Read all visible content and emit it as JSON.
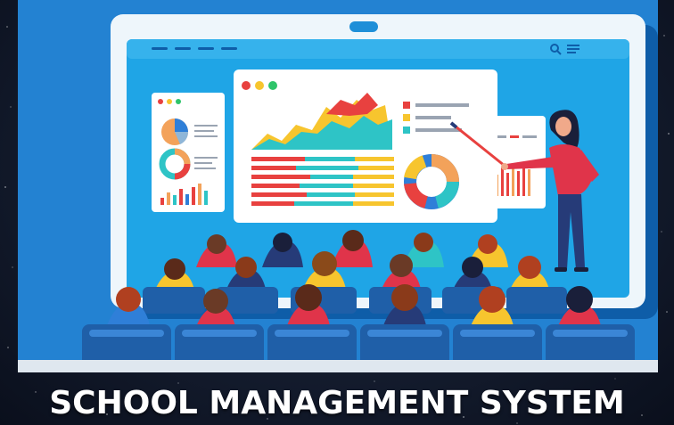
{
  "title": "SCHOOL MANAGEMENT SYSTEM",
  "illustration": {
    "subject": "classroom-presentation",
    "colors": {
      "background_blue": "#1f7fd0",
      "screen_frame": "#eef6fb",
      "screen_inner": "#1fa5e6",
      "accent_red": "#e8413f",
      "accent_yellow": "#f7c52e",
      "accent_teal": "#2ec4c6",
      "seat_blue": "#1f5fa8",
      "presenter_top": "#e0344a",
      "presenter_pants": "#263b78"
    }
  }
}
